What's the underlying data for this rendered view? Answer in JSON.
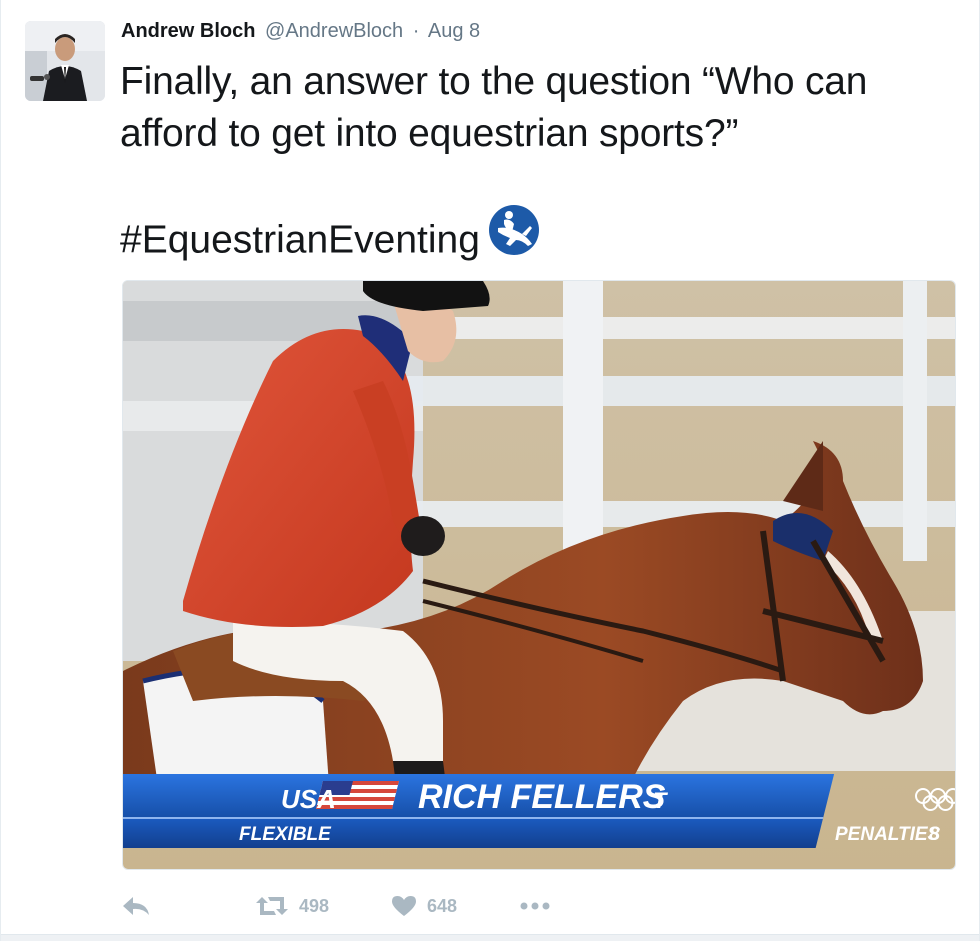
{
  "tweet": {
    "author_name": "Andrew Bloch",
    "author_handle": "@AndrewBloch",
    "separator": "·",
    "date": "Aug 8",
    "text": "Finally, an answer to the question “Who can afford to get into equestrian sports?”",
    "hashtag": "#EquestrianEventing",
    "hashtag_emoji_icon": "equestrian-pictogram-icon"
  },
  "media": {
    "lower_third": {
      "country": "USA",
      "rider_name": "RICH FELLERS",
      "rider_suffix": "T",
      "subtitle": "FLEXIBLE",
      "penalties_label": "PENALTIES",
      "penalties_value": "8"
    }
  },
  "actions": {
    "reply_icon": "reply-arrow-icon",
    "retweet_icon": "retweet-icon",
    "retweet_count": "498",
    "like_icon": "heart-icon",
    "like_count": "648",
    "more_icon": "more-dots-icon"
  },
  "colors": {
    "text": "#14171a",
    "muted": "#657786",
    "action_gray": "#aab8c2",
    "broadcast_blue": "#1f5fc8",
    "emoji_blue": "#1d5aa8"
  }
}
